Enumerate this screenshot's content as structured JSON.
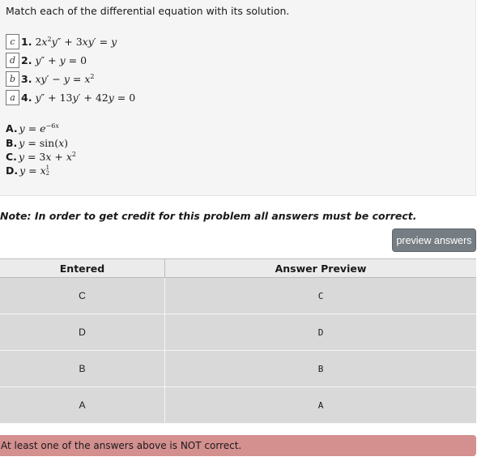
{
  "problem": {
    "intro": "Match each of the differential equation with its solution.",
    "questions": [
      {
        "answer": "c",
        "num": "1."
      },
      {
        "answer": "d",
        "num": "2."
      },
      {
        "answer": "b",
        "num": "3."
      },
      {
        "answer": "a",
        "num": "4."
      }
    ],
    "options": [
      {
        "letter": "A."
      },
      {
        "letter": "B."
      },
      {
        "letter": "C."
      },
      {
        "letter": "D."
      }
    ]
  },
  "note": "Note: In order to get credit for this problem all answers must be correct.",
  "preview_button": "preview answers",
  "results": {
    "headers": [
      "Entered",
      "Answer Preview"
    ],
    "rows": [
      {
        "entered": "C",
        "preview": "C"
      },
      {
        "entered": "D",
        "preview": "D"
      },
      {
        "entered": "B",
        "preview": "B"
      },
      {
        "entered": "A",
        "preview": "A"
      }
    ]
  },
  "alert": "At least one of the answers above is NOT correct."
}
